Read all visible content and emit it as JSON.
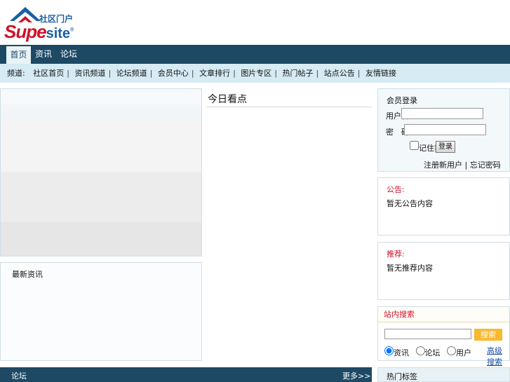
{
  "logo": {
    "brand": "Supe",
    "brand_suffix": "site",
    "cn": "社区门户",
    "mark": "®"
  },
  "nav": {
    "tabs": [
      {
        "label": "首页"
      },
      {
        "label": "资讯"
      },
      {
        "label": "论坛"
      }
    ]
  },
  "subnav": {
    "label": "频道:",
    "items": [
      "社区首页",
      "资讯频道",
      "论坛频道",
      "会员中心",
      "文章排行",
      "图片专区",
      "热门帖子",
      "站点公告",
      "友情链接"
    ]
  },
  "left": {
    "news_title": "最新资讯"
  },
  "middle": {
    "title": "今日看点"
  },
  "login": {
    "title": "会员登录",
    "username_label": "用户名:",
    "password_label": "密　码:",
    "remember_label": "记住我",
    "submit_label": "登录",
    "register_link": "注册新用户",
    "forgot_link": "忘记密码"
  },
  "box1": {
    "title": "公告:",
    "text": "暂无公告内容"
  },
  "box2": {
    "title": "推荐:",
    "text": "暂无推荐内容"
  },
  "search": {
    "title": "站内搜索",
    "button": "搜索",
    "options": [
      "资讯",
      "论坛",
      "用户"
    ],
    "advanced": "高级搜索"
  },
  "bottom": {
    "left": "论坛",
    "more": "更多>>",
    "right_title": "热门标签"
  },
  "colors": {
    "nav": "#1d4965",
    "accent": "#d0112b",
    "subnav": "#d6ebf4",
    "search_btn": "#f9b82e"
  }
}
